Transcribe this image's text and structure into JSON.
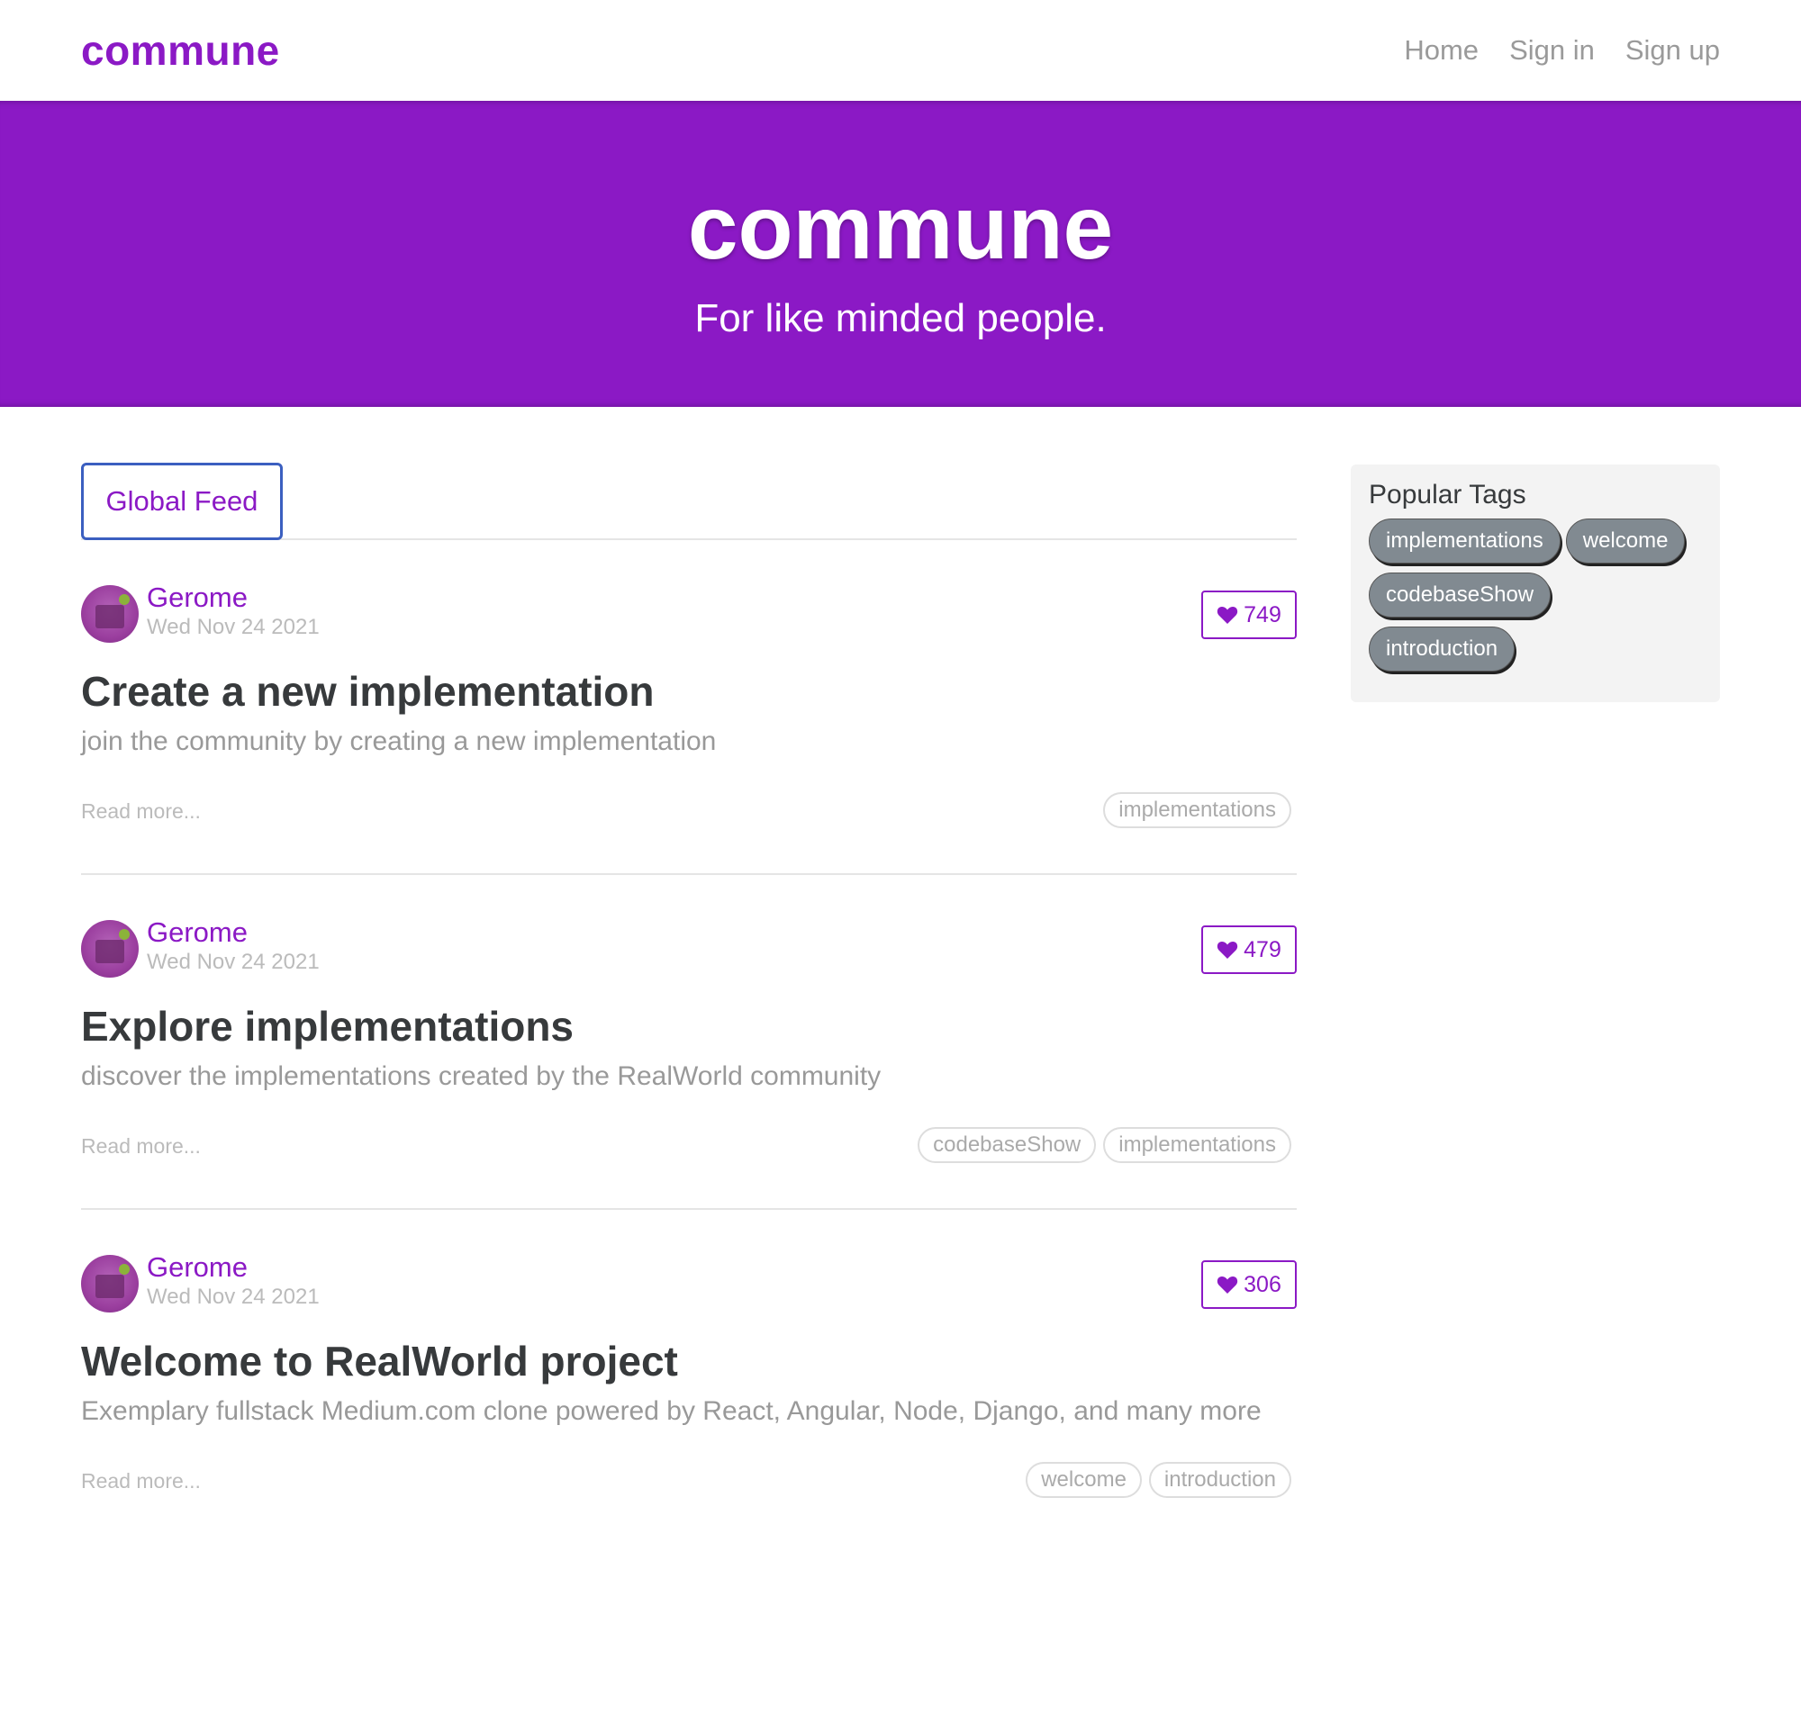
{
  "nav": {
    "brand": "commune",
    "links": [
      "Home",
      "Sign in",
      "Sign up"
    ]
  },
  "banner": {
    "title": "commune",
    "subtitle": "For like minded people."
  },
  "feed": {
    "tab": "Global Feed",
    "articles": [
      {
        "author": "Gerome",
        "date": "Wed Nov 24 2021",
        "likes": "749",
        "title": "Create a new implementation",
        "description": "join the community by creating a new implementation",
        "read_more": "Read more...",
        "tags": [
          "implementations"
        ]
      },
      {
        "author": "Gerome",
        "date": "Wed Nov 24 2021",
        "likes": "479",
        "title": "Explore implementations",
        "description": "discover the implementations created by the RealWorld community",
        "read_more": "Read more...",
        "tags": [
          "codebaseShow",
          "implementations"
        ]
      },
      {
        "author": "Gerome",
        "date": "Wed Nov 24 2021",
        "likes": "306",
        "title": "Welcome to RealWorld project",
        "description": "Exemplary fullstack Medium.com clone powered by React, Angular, Node, Django, and many more",
        "read_more": "Read more...",
        "tags": [
          "welcome",
          "introduction"
        ]
      }
    ]
  },
  "sidebar": {
    "title": "Popular Tags",
    "tags": [
      "implementations",
      "welcome",
      "codebaseShow",
      "introduction"
    ]
  },
  "colors": {
    "accent": "#8b19c5",
    "tag_pill": "#818a91"
  },
  "icons": {
    "like": "heart-icon",
    "avatar": "avatar"
  }
}
